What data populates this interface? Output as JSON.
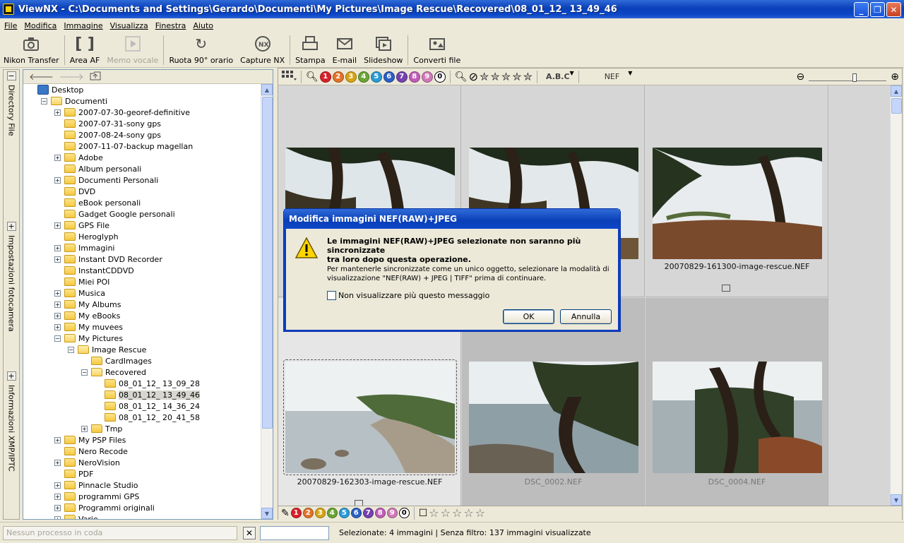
{
  "window": {
    "title": "ViewNX - C:\\Documents and Settings\\Gerardo\\Documenti\\My Pictures\\Image Rescue\\Recovered\\08_01_12_ 13_49_46",
    "minimize": "_",
    "maximize": "❐",
    "close": "✕"
  },
  "menu": [
    "File",
    "Modifica",
    "Immagine",
    "Visualizza",
    "Finestra",
    "Aiuto"
  ],
  "toolbar": {
    "nikon_transfer": "Nikon Transfer",
    "area_af": "Area AF",
    "memo_vocale": "Memo vocale",
    "ruota": "Ruota 90° orario",
    "capture_nx": "Capture NX",
    "stampa": "Stampa",
    "email": "E-mail",
    "slideshow": "Slideshow",
    "converti": "Converti file"
  },
  "side_tabs": {
    "directory": "Directory File",
    "impostazioni": "Impostazioni fotocamera",
    "informazioni": "Informazioni XMP/IPTC"
  },
  "tree": [
    {
      "label": "Desktop",
      "level": 0,
      "expander": "none",
      "icon": "desktop-icon"
    },
    {
      "label": "Documenti",
      "level": 1,
      "expander": "minus",
      "icon": "documents-folder-icon"
    },
    {
      "label": "2007-07-30-georef-definitive",
      "level": 2,
      "expander": "plus"
    },
    {
      "label": "2007-07-31-sony gps",
      "level": 2,
      "expander": "none"
    },
    {
      "label": "2007-08-24-sony gps",
      "level": 2,
      "expander": "none"
    },
    {
      "label": "2007-11-07-backup magellan",
      "level": 2,
      "expander": "none"
    },
    {
      "label": "Adobe",
      "level": 2,
      "expander": "plus"
    },
    {
      "label": "Album personali",
      "level": 2,
      "expander": "none"
    },
    {
      "label": "Documenti Personali",
      "level": 2,
      "expander": "plus"
    },
    {
      "label": "DVD",
      "level": 2,
      "expander": "none"
    },
    {
      "label": "eBook personali",
      "level": 2,
      "expander": "none"
    },
    {
      "label": "Gadget Google personali",
      "level": 2,
      "expander": "none"
    },
    {
      "label": "GPS File",
      "level": 2,
      "expander": "plus"
    },
    {
      "label": "Heroglyph",
      "level": 2,
      "expander": "none"
    },
    {
      "label": "Immagini",
      "level": 2,
      "expander": "plus"
    },
    {
      "label": "Instant DVD Recorder",
      "level": 2,
      "expander": "plus"
    },
    {
      "label": "InstantCDDVD",
      "level": 2,
      "expander": "none"
    },
    {
      "label": "Miei POI",
      "level": 2,
      "expander": "none"
    },
    {
      "label": "Musica",
      "level": 2,
      "expander": "plus"
    },
    {
      "label": "My Albums",
      "level": 2,
      "expander": "plus"
    },
    {
      "label": "My eBooks",
      "level": 2,
      "expander": "plus"
    },
    {
      "label": "My muvees",
      "level": 2,
      "expander": "plus"
    },
    {
      "label": "My Pictures",
      "level": 2,
      "expander": "minus"
    },
    {
      "label": "Image Rescue",
      "level": 3,
      "expander": "minus"
    },
    {
      "label": "CardImages",
      "level": 4,
      "expander": "none"
    },
    {
      "label": "Recovered",
      "level": 4,
      "expander": "minus"
    },
    {
      "label": "08_01_12_ 13_09_28",
      "level": 5,
      "expander": "none"
    },
    {
      "label": "08_01_12_ 13_49_46",
      "level": 5,
      "expander": "none",
      "selected": true
    },
    {
      "label": "08_01_12_ 14_36_24",
      "level": 5,
      "expander": "none"
    },
    {
      "label": "08_01_12_ 20_41_58",
      "level": 5,
      "expander": "none"
    },
    {
      "label": "Tmp",
      "level": 4,
      "expander": "plus"
    },
    {
      "label": "My PSP Files",
      "level": 2,
      "expander": "plus"
    },
    {
      "label": "Nero Recode",
      "level": 2,
      "expander": "none"
    },
    {
      "label": "NeroVision",
      "level": 2,
      "expander": "plus"
    },
    {
      "label": "PDF",
      "level": 2,
      "expander": "none"
    },
    {
      "label": "Pinnacle Studio",
      "level": 2,
      "expander": "plus"
    },
    {
      "label": "programmi GPS",
      "level": 2,
      "expander": "plus"
    },
    {
      "label": "Programmi originali",
      "level": 2,
      "expander": "plus"
    },
    {
      "label": "Varie",
      "level": 2,
      "expander": "plus"
    }
  ],
  "filter_bar": {
    "labels": [
      "1",
      "2",
      "3",
      "4",
      "5",
      "6",
      "7",
      "8",
      "9",
      "0"
    ],
    "label_colors": [
      "#d8202a",
      "#e2732a",
      "#d6a417",
      "#6aa535",
      "#2a9ad8",
      "#2b5fc6",
      "#7542b0",
      "#c05db8",
      "#d07ab8"
    ],
    "sort_label": "A.B.C",
    "type_filter": "NEF"
  },
  "thumbnails": [
    {
      "caption": "",
      "gray": false
    },
    {
      "caption": "",
      "gray": false
    },
    {
      "caption": "20070829-161300-image-rescue.NEF",
      "gray": false
    },
    {
      "caption": "20070829-162303-image-rescue.NEF",
      "gray": false,
      "selected": true
    },
    {
      "caption": "DSC_0002.NEF",
      "gray": true
    },
    {
      "caption": "DSC_0004.NEF",
      "gray": true
    }
  ],
  "dialog": {
    "title": "Modifica immagini NEF(RAW)+JPEG",
    "main_line1": "Le immagini NEF(RAW)+JPEG selezionate non saranno più sincronizzate",
    "main_line2": "tra loro dopo questa operazione.",
    "sub_line1": "Per mantenerle sincronizzate come un unico oggetto, selezionare la modalità di",
    "sub_line2": "visualizzazione \"NEF(RAW) + JPEG | TIFF\" prima di continuare.",
    "checkbox": "Non visualizzare più questo messaggio",
    "ok": "OK",
    "cancel": "Annulla"
  },
  "status": {
    "queue": "Nessun processo in coda",
    "cancel_x": "✕",
    "text": "Selezionate: 4 immagini | Senza filtro: 137 immagini visualizzate"
  }
}
